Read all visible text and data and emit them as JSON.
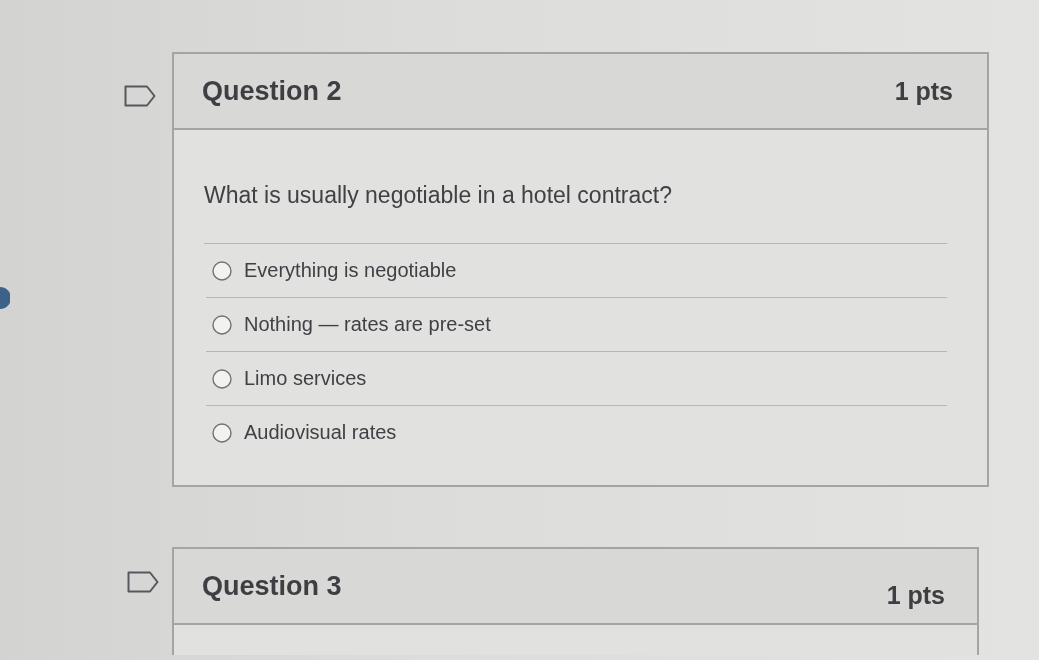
{
  "questions": [
    {
      "title": "Question 2",
      "points": "1 pts",
      "flagged": false,
      "prompt": "What is usually negotiable in a hotel contract?",
      "answers": [
        {
          "label": "Everything is negotiable",
          "selected": false
        },
        {
          "label": "Nothing — rates are pre-set",
          "selected": false
        },
        {
          "label": "Limo services",
          "selected": false
        },
        {
          "label": "Audiovisual rates",
          "selected": false
        }
      ]
    },
    {
      "title": "Question 3",
      "points": "1 pts",
      "flagged": false
    }
  ]
}
